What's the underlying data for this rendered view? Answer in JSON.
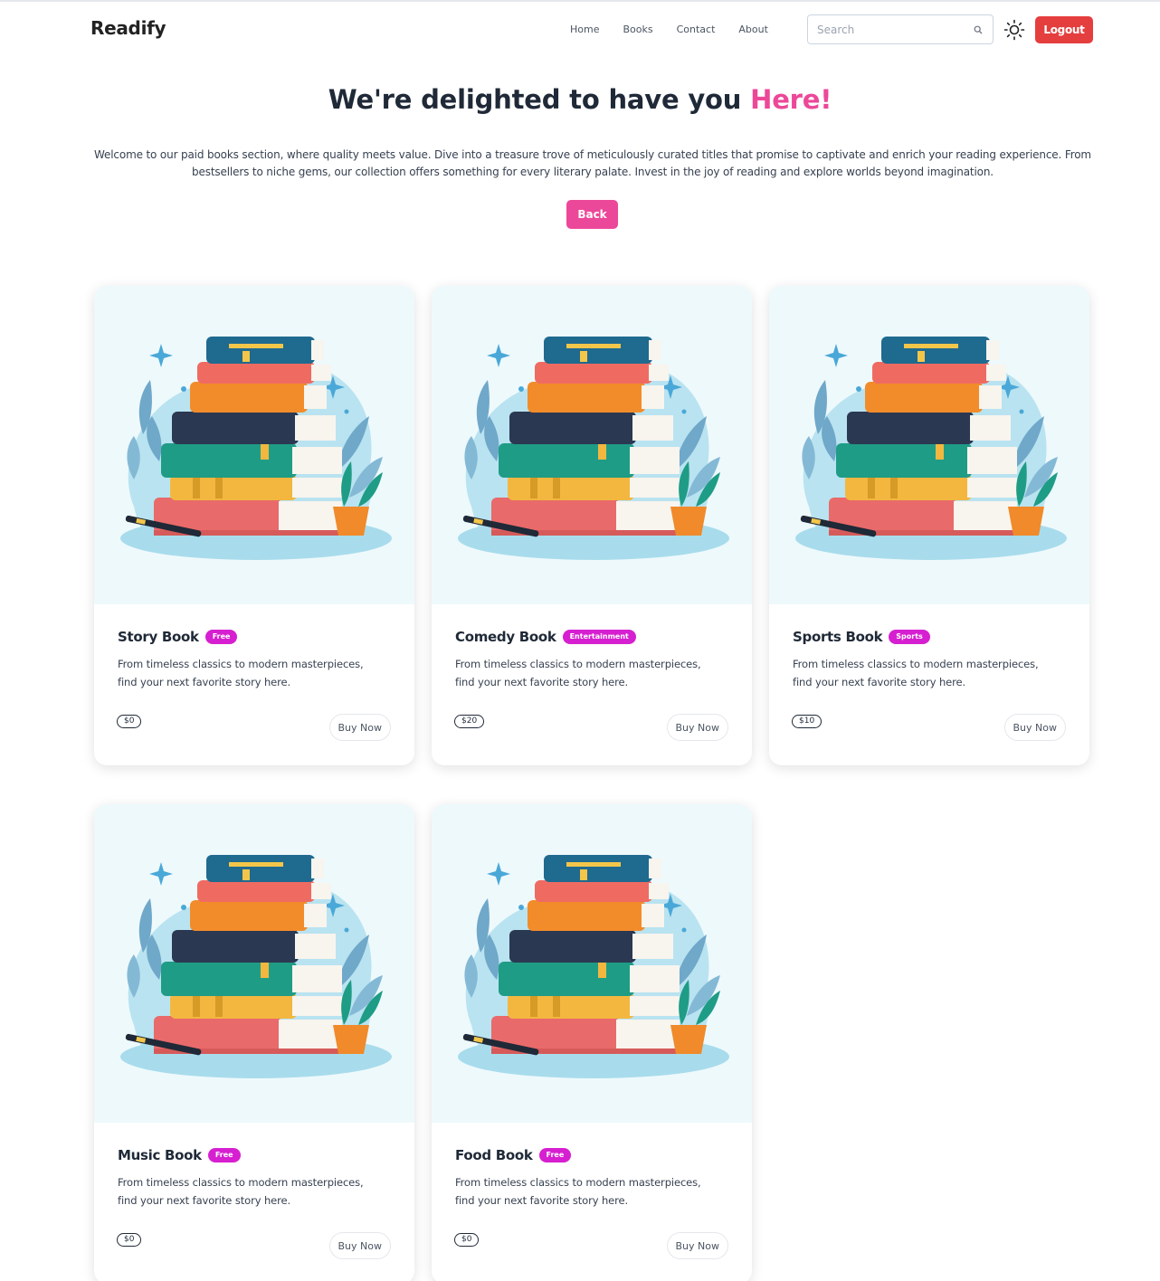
{
  "navbar": {
    "brand": "Readify",
    "links": [
      "Home",
      "Books",
      "Contact",
      "About"
    ],
    "search_placeholder": "Search",
    "logout_label": "Logout",
    "icons": {
      "search": "search-icon",
      "theme": "sun-icon"
    },
    "colors": {
      "logout": "#e53e3e"
    }
  },
  "hero": {
    "title_main": "We're delighted to have you ",
    "title_accent": "Here!",
    "description": "Welcome to our paid books section, where quality meets value. Dive into a treasure trove of meticulously curated titles that promise to captivate and enrich your reading experience. From bestsellers to niche gems, our collection offers something for every literary palate. Invest in the joy of reading and explore worlds beyond imagination.",
    "back_label": "Back",
    "colors": {
      "accent": "#ec4899"
    }
  },
  "cards": [
    {
      "title": "Story Book",
      "badge": "Free",
      "description": "From timeless classics to modern masterpieces, find your next favorite story here.",
      "price": "$0",
      "buy_label": "Buy Now"
    },
    {
      "title": "Comedy Book",
      "badge": "Entertainment",
      "description": "From timeless classics to modern masterpieces, find your next favorite story here.",
      "price": "$20",
      "buy_label": "Buy Now"
    },
    {
      "title": "Sports Book",
      "badge": "Sports",
      "description": "From timeless classics to modern masterpieces, find your next favorite story here.",
      "price": "$10",
      "buy_label": "Buy Now"
    },
    {
      "title": "Music Book",
      "badge": "Free",
      "description": "From timeless classics to modern masterpieces, find your next favorite story here.",
      "price": "$0",
      "buy_label": "Buy Now"
    },
    {
      "title": "Food Book",
      "badge": "Free",
      "description": "From timeless classics to modern masterpieces, find your next favorite story here.",
      "price": "$0",
      "buy_label": "Buy Now"
    }
  ],
  "colors": {
    "badge": "#d61fd0",
    "figure_background": "#eef9fc"
  }
}
